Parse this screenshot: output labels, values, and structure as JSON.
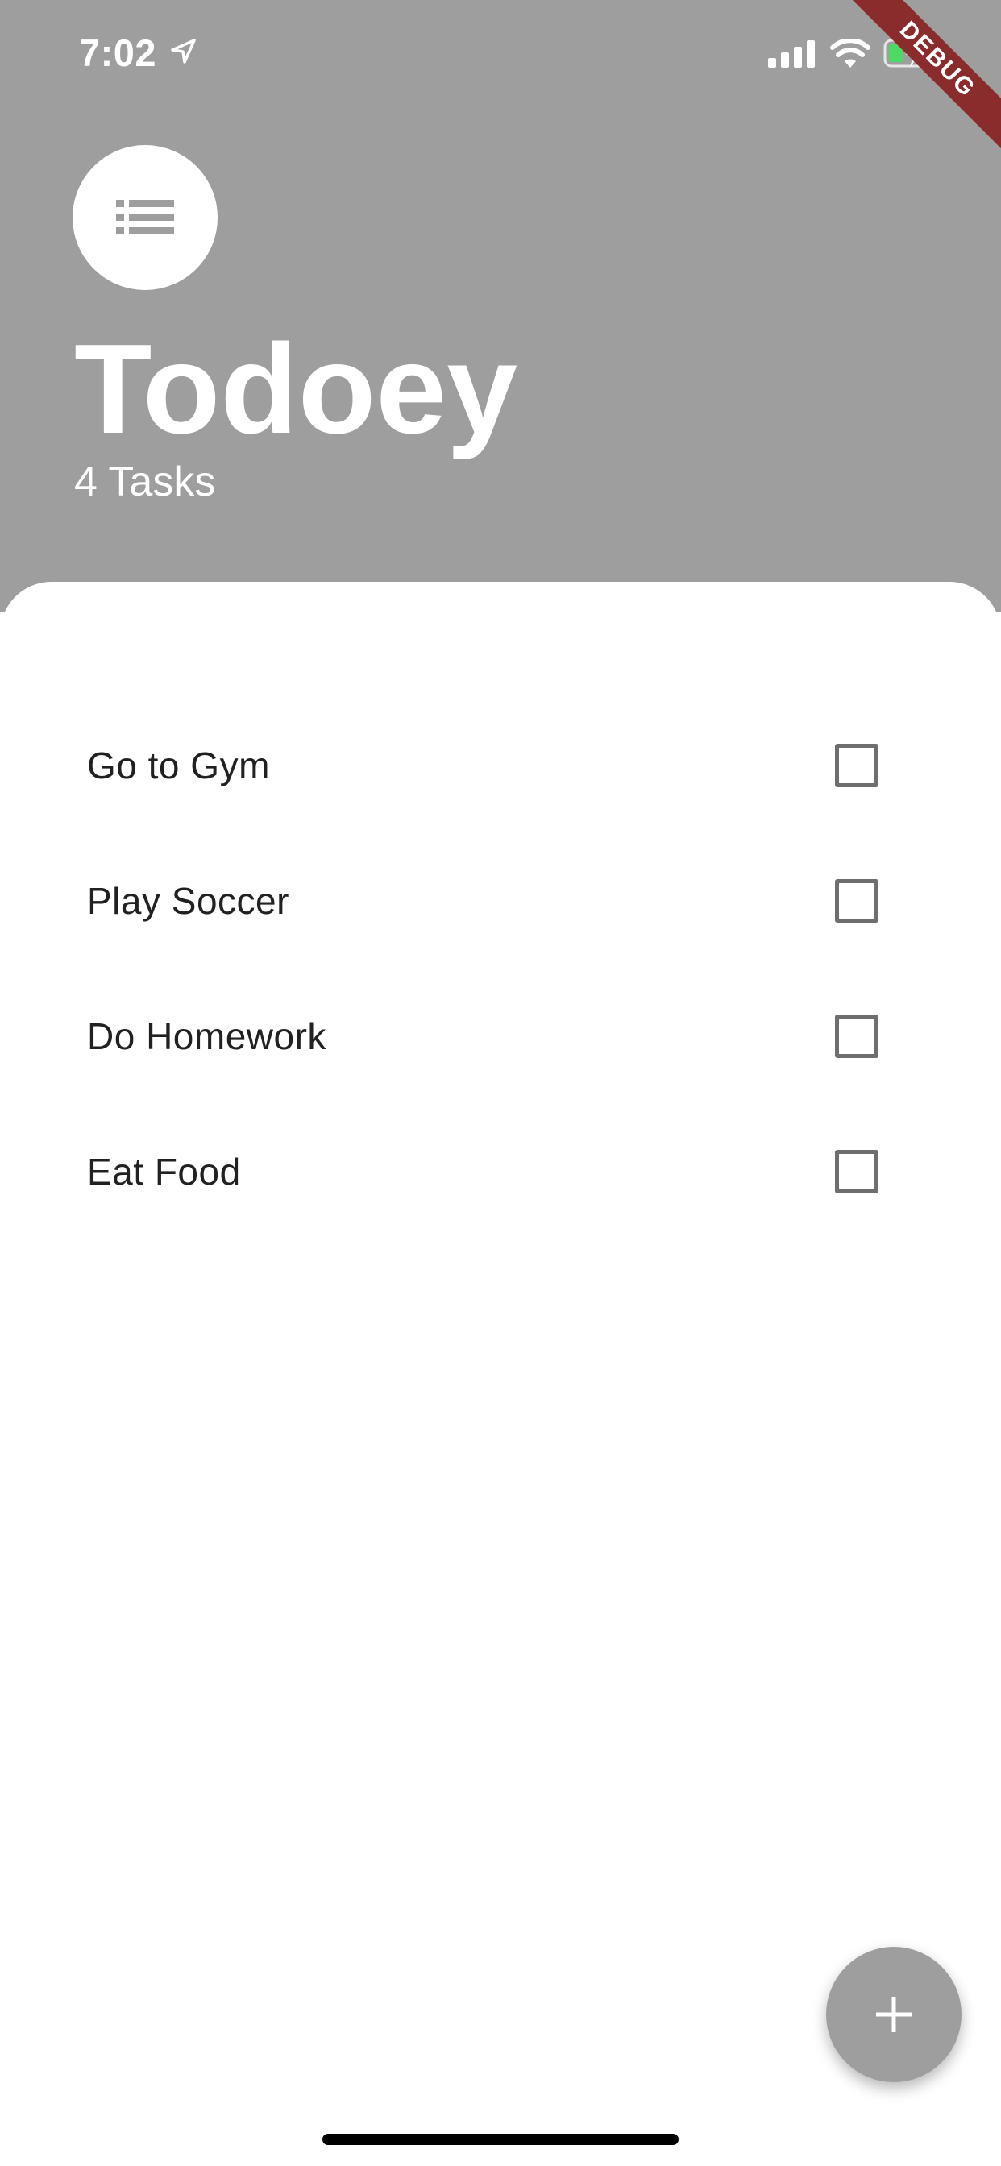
{
  "status_bar": {
    "time": "7:02",
    "icons": [
      "location-arrow-icon",
      "cellular-signal-icon",
      "wifi-icon",
      "battery-charging-icon"
    ]
  },
  "debug_banner": {
    "label": "DEBUG",
    "color": "#8b2c2c"
  },
  "header": {
    "menu_icon": "list-icon",
    "title": "Todoey",
    "task_count": "4 Tasks",
    "background_color": "#9e9e9e"
  },
  "tasks": [
    {
      "label": "Go to Gym",
      "checked": false
    },
    {
      "label": "Play Soccer",
      "checked": false
    },
    {
      "label": "Do Homework",
      "checked": false
    },
    {
      "label": "Eat Food",
      "checked": false
    }
  ],
  "fab": {
    "icon": "plus-icon",
    "color": "#9e9e9e"
  }
}
